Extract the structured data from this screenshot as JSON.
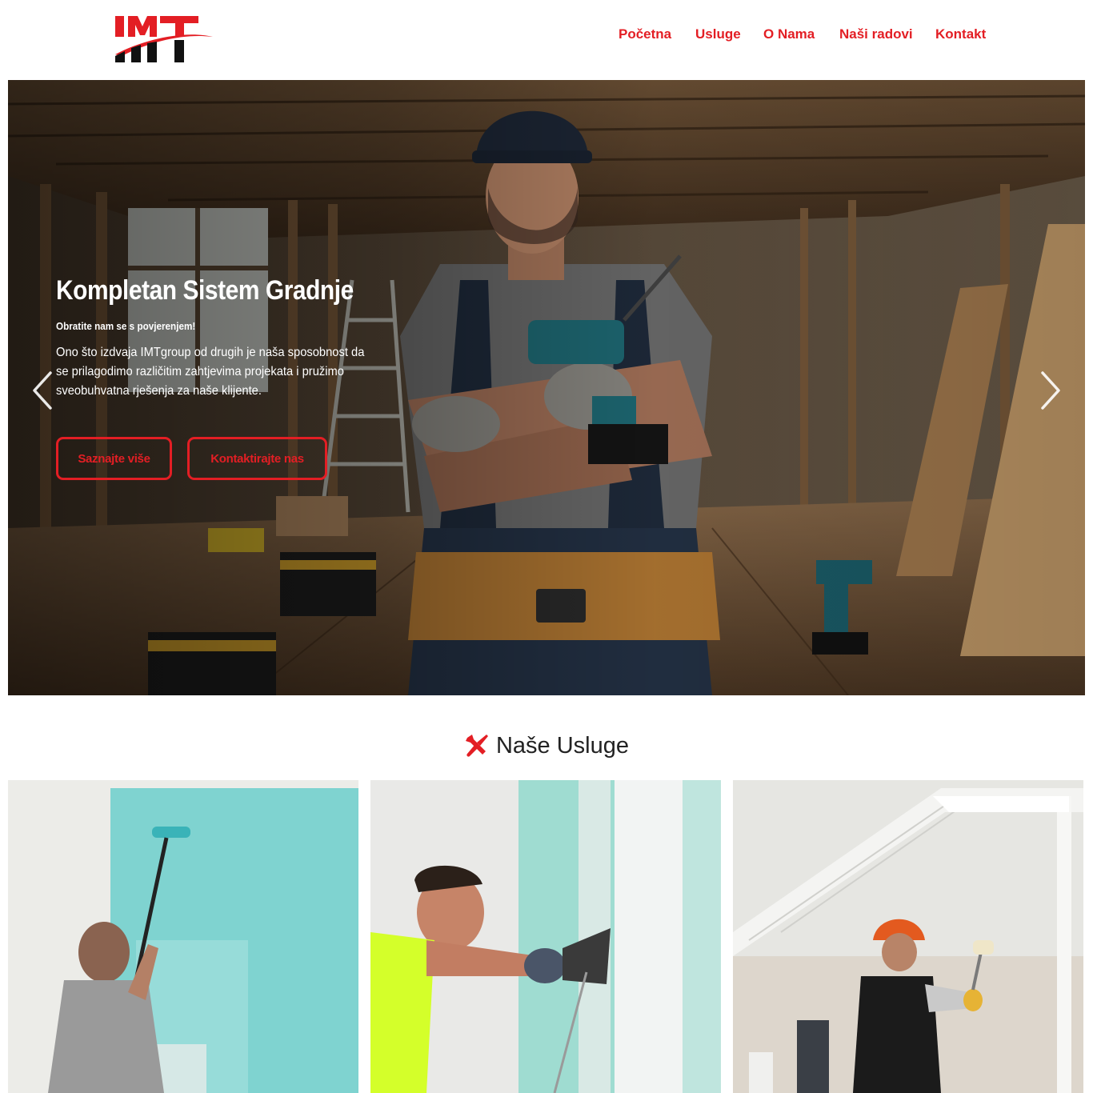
{
  "brand": {
    "logo_text": "IMT",
    "accent_color": "#e31e24"
  },
  "nav": {
    "items": [
      {
        "label": "Početna"
      },
      {
        "label": "Usluge"
      },
      {
        "label": "O Nama"
      },
      {
        "label": "Naši radovi"
      },
      {
        "label": "Kontakt"
      }
    ]
  },
  "hero": {
    "title": "Kompletan Sistem Gradnje",
    "subtitle": "Obratite nam se s povjerenjem!",
    "text": "Ono što izdvaja IMTgroup od drugih je naša sposobnost da se prilagodimo različitim zahtjevima projekata i pružimo sveobuhvatna rješenja za naše klijente.",
    "primary_button": "Saznajte više",
    "secondary_button": "Kontaktirajte nas",
    "prev_icon": "chevron-left-icon",
    "next_icon": "chevron-right-icon"
  },
  "services": {
    "heading": "Naše Usluge",
    "heading_icon": "tools-icon"
  }
}
